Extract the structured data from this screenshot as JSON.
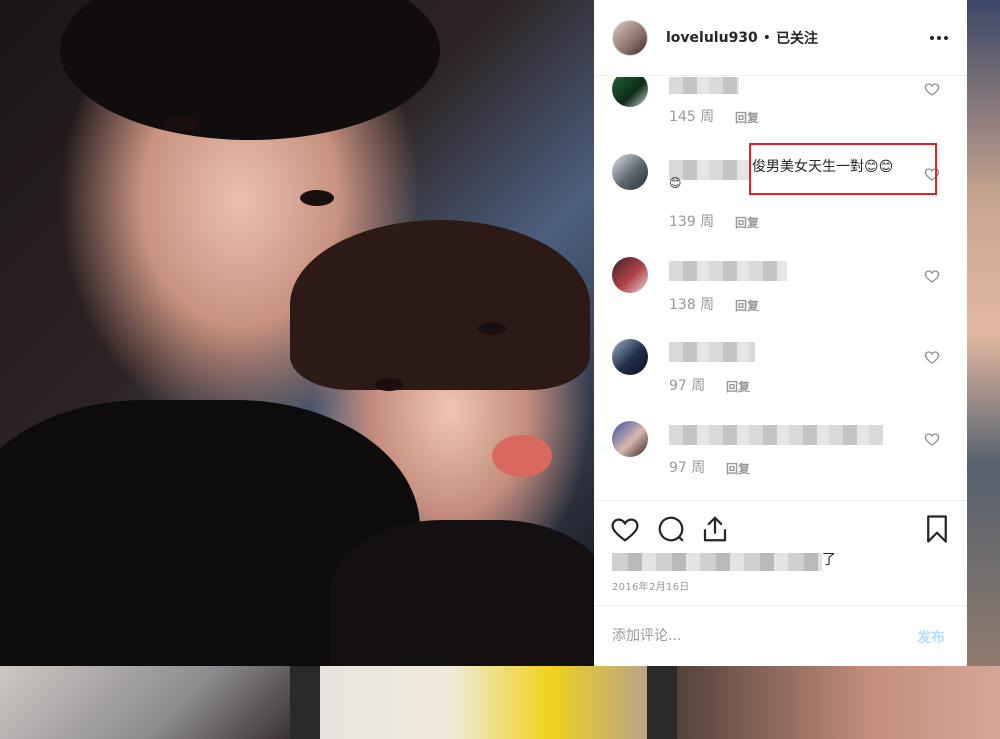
{
  "header": {
    "username": "lovelulu930",
    "separator": "•",
    "follow_status": "已关注"
  },
  "comments": [
    {
      "time": "145 周",
      "reply": "回复"
    },
    {
      "text_line1": "俊男美女天生一對😊😊",
      "text_line2": "😊",
      "time": "139 周",
      "reply": "回复"
    },
    {
      "time": "138 周",
      "reply": "回复"
    },
    {
      "time": "97 周",
      "reply": "回复"
    },
    {
      "time": "97 周",
      "reply": "回复"
    }
  ],
  "likes": {
    "suffix": "了"
  },
  "post": {
    "date": "2016年2月16日"
  },
  "add_comment": {
    "placeholder": "添加评论...",
    "post_label": "发布"
  },
  "colors": {
    "highlight_box": "#e0202a",
    "post_button": "#b2dffc",
    "secondary_text": "#999999"
  }
}
